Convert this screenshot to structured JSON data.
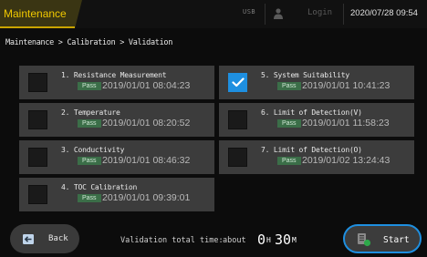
{
  "header": {
    "title": "Maintenance",
    "usb_label": "USB",
    "login_label": "Login",
    "datetime": "2020/07/28 09:54"
  },
  "breadcrumb": "Maintenance > Calibration > Validation",
  "items": [
    {
      "label": "1. Resistance Measurement",
      "status": "Pass",
      "timestamp": "2019/01/01 08:04:23",
      "checked": false
    },
    {
      "label": "2. Temperature",
      "status": "Pass",
      "timestamp": "2019/01/01 08:20:52",
      "checked": false
    },
    {
      "label": "3. Conductivity",
      "status": "Pass",
      "timestamp": "2019/01/01 08:46:32",
      "checked": false
    },
    {
      "label": "4. TOC Calibration",
      "status": "Pass",
      "timestamp": "2019/01/01 09:39:01",
      "checked": false
    },
    {
      "label": "5. System Suitability",
      "status": "Pass",
      "timestamp": "2019/01/01 10:41:23",
      "checked": true
    },
    {
      "label": "6. Limit of Detection(V)",
      "status": "Pass",
      "timestamp": "2019/01/01 11:58:23",
      "checked": false
    },
    {
      "label": "7. Limit of Detection(O)",
      "status": "Pass",
      "timestamp": "2019/01/02 13:24:43",
      "checked": false
    }
  ],
  "footer": {
    "back_label": "Back",
    "total_time_label": "Validation total time:",
    "about_label": "about",
    "hours_value": "0",
    "hours_unit": "H",
    "minutes_value": "30",
    "minutes_unit": "M",
    "start_label": "Start"
  },
  "colors": {
    "accent": "#1e8fe0",
    "title": "#f0c800",
    "pass_badge": "#3b6e48"
  }
}
